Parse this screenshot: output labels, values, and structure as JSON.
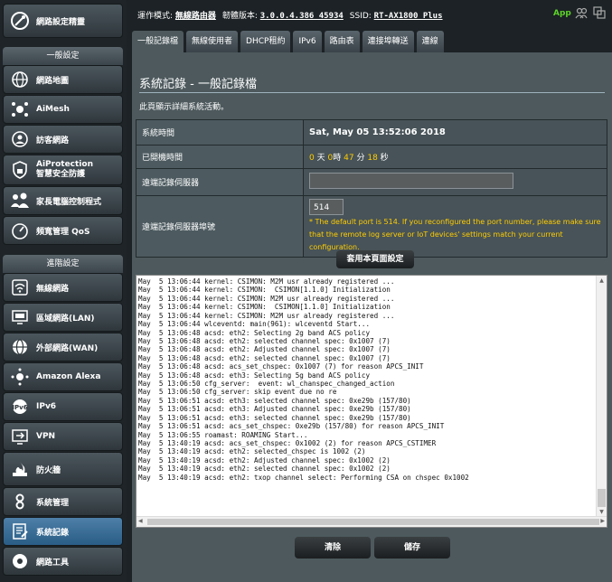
{
  "sidebar": {
    "quick_setup": "網路設定精靈",
    "general_header": "一般設定",
    "general_items": [
      {
        "label": "網路地圖",
        "icon": "globe-icon"
      },
      {
        "label": "AiMesh",
        "icon": "mesh-icon"
      },
      {
        "label": "訪客網路",
        "icon": "guest-network-icon"
      },
      {
        "label": "AiProtection",
        "label2": "智慧安全防護",
        "icon": "shield-lock-icon"
      },
      {
        "label": "家長電腦控制程式",
        "icon": "family-icon"
      },
      {
        "label": "頻寬管理 QoS",
        "icon": "speedometer-icon"
      }
    ],
    "advanced_header": "進階設定",
    "advanced_items": [
      {
        "label": "無線網路",
        "icon": "wifi-icon"
      },
      {
        "label": "區域網路(LAN)",
        "icon": "lan-icon"
      },
      {
        "label": "外部網路(WAN)",
        "icon": "wan-globe-icon"
      },
      {
        "label": "Amazon Alexa",
        "icon": "alexa-icon"
      },
      {
        "label": "IPv6",
        "icon": "ipv6-icon"
      },
      {
        "label": "VPN",
        "icon": "vpn-icon"
      },
      {
        "label": "防火牆",
        "icon": "firewall-icon"
      },
      {
        "label": "系統管理",
        "icon": "admin-icon"
      },
      {
        "label": "系統記錄",
        "icon": "system-log-icon"
      },
      {
        "label": "網路工具",
        "icon": "network-tools-icon"
      }
    ]
  },
  "topbar": {
    "mode_label": "運作模式:",
    "mode_value": "無線路由器",
    "fw_label": "韌體版本:",
    "fw_value": "3.0.0.4.386_45934",
    "ssid_label": "SSID:",
    "ssid_value": "RT-AX1800_Plus",
    "app_label": "App"
  },
  "tabs": [
    "一般記錄檔",
    "無線使用者",
    "DHCP租約",
    "IPv6",
    "路由表",
    "連接埠轉送",
    "連線"
  ],
  "page": {
    "title": "系統記錄 - 一般記錄檔",
    "description": "此頁顯示詳細系統活動。",
    "rows": {
      "system_time_label": "系統時間",
      "system_time_value": "Sat, May 05 13:52:06 2018",
      "uptime_label": "已開機時間",
      "uptime": {
        "days": "0",
        "days_unit": "天",
        "hours": "0",
        "hours_unit": "時",
        "minutes": "47",
        "minutes_unit": "分",
        "seconds": "18",
        "seconds_unit": "秒"
      },
      "remote_server_label": "遠端記錄伺服器",
      "remote_server_value": "",
      "remote_port_label": "遠端記錄伺服器埠號",
      "remote_port_value": "514",
      "port_note": "* The default port is 514. If you reconfigured the port number, please make sure that the remote log server or IoT devices' settings match your current configuration."
    },
    "apply_button": "套用本頁面設定",
    "clear_button": "清除",
    "save_button": "儲存",
    "log_lines": [
      "May  5 13:06:44 kernel: CSIMON: M2M usr already registered ...",
      "May  5 13:06:44 kernel: CSIMON:  CSIMON[1.1.0] Initialization",
      "May  5 13:06:44 kernel: CSIMON: M2M usr already registered ...",
      "May  5 13:06:44 kernel: CSIMON:  CSIMON[1.1.0] Initialization",
      "May  5 13:06:44 kernel: CSIMON: M2M usr already registered ...",
      "May  5 13:06:44 wlceventd: main(961): wlceventd Start...",
      "May  5 13:06:48 acsd: eth2: Selecting 2g band ACS policy",
      "May  5 13:06:48 acsd: eth2: selected channel spec: 0x1007 (7)",
      "May  5 13:06:48 acsd: eth2: Adjusted channel spec: 0x1007 (7)",
      "May  5 13:06:48 acsd: eth2: selected channel spec: 0x1007 (7)",
      "May  5 13:06:48 acsd: acs_set_chspec: 0x1007 (7) for reason APCS_INIT",
      "May  5 13:06:48 acsd: eth3: Selecting 5g band ACS policy",
      "May  5 13:06:50 cfg_server:  event: wl_chanspec_changed_action",
      "May  5 13:06:50 cfg_server: skip event due no re",
      "May  5 13:06:51 acsd: eth3: selected channel spec: 0xe29b (157/80)",
      "May  5 13:06:51 acsd: eth3: Adjusted channel spec: 0xe29b (157/80)",
      "May  5 13:06:51 acsd: eth3: selected channel spec: 0xe29b (157/80)",
      "May  5 13:06:51 acsd: acs_set_chspec: 0xe29b (157/80) for reason APCS_INIT",
      "May  5 13:06:55 roamast: ROAMING Start...",
      "May  5 13:40:19 acsd: acs_set_chspec: 0x1002 (2) for reason APCS_CSTIMER",
      "May  5 13:40:19 acsd: eth2: selected_chspec is 1002 (2)",
      "May  5 13:40:19 acsd: eth2: Adjusted channel spec: 0x1002 (2)",
      "May  5 13:40:19 acsd: eth2: selected channel spec: 0x1002 (2)",
      "May  5 13:40:19 acsd: eth2: txop channel select: Performing CSA on chspec 0x1002"
    ]
  },
  "colors": {
    "accent_yellow": "#ffcc00",
    "panel": "#4d595d",
    "active_nav": "#2a5d86",
    "app_green": "#5dd22a"
  }
}
